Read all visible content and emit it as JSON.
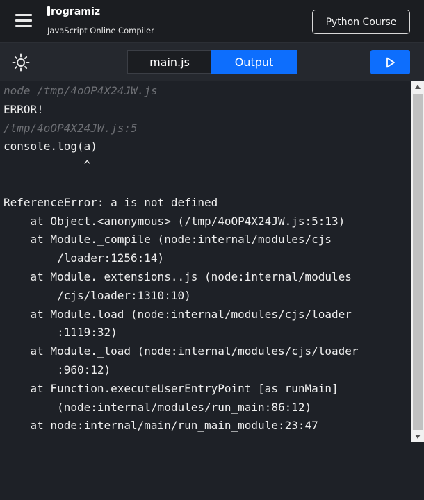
{
  "header": {
    "logo_text": "rogramiz",
    "subtitle": "JavaScript Online Compiler",
    "course_button": "Python Course"
  },
  "toolbar": {
    "tabs": [
      {
        "label": "main.js",
        "active": false
      },
      {
        "label": "Output",
        "active": true
      }
    ],
    "run_icon": "play-icon",
    "theme_icon": "sun-icon"
  },
  "output": {
    "lines": [
      {
        "text": "node /tmp/4oOP4X24JW.js",
        "style": "dim"
      },
      {
        "text": "ERROR!",
        "style": "normal"
      },
      {
        "text": "/tmp/4oOP4X24JW.js:5",
        "style": "dim"
      },
      {
        "text": "console.log(a)",
        "style": "normal"
      },
      {
        "text": "            ^",
        "style": "normal"
      },
      {
        "text": "",
        "style": "normal"
      },
      {
        "text": "ReferenceError: a is not defined",
        "style": "normal"
      },
      {
        "text": "    at Object.<anonymous> (/tmp/4oOP4X24JW.js:5:13)",
        "style": "normal"
      },
      {
        "text": "    at Module._compile (node:internal/modules/cjs",
        "style": "normal"
      },
      {
        "text": "        /loader:1256:14)",
        "style": "normal"
      },
      {
        "text": "    at Module._extensions..js (node:internal/modules",
        "style": "normal"
      },
      {
        "text": "        /cjs/loader:1310:10)",
        "style": "normal"
      },
      {
        "text": "    at Module.load (node:internal/modules/cjs/loader",
        "style": "normal"
      },
      {
        "text": "        :1119:32)",
        "style": "normal"
      },
      {
        "text": "    at Module._load (node:internal/modules/cjs/loader",
        "style": "normal"
      },
      {
        "text": "        :960:12)",
        "style": "normal"
      },
      {
        "text": "    at Function.executeUserEntryPoint [as runMain]",
        "style": "normal"
      },
      {
        "text": "        (node:internal/modules/run_main:86:12)",
        "style": "normal"
      },
      {
        "text": "    at node:internal/main/run_main_module:23:47",
        "style": "normal"
      }
    ]
  },
  "colors": {
    "accent": "#0d6efd",
    "background": "#1e2127",
    "header_bg": "#1b1d21",
    "text": "#eeeeee",
    "dim_text": "#6d6f74"
  }
}
